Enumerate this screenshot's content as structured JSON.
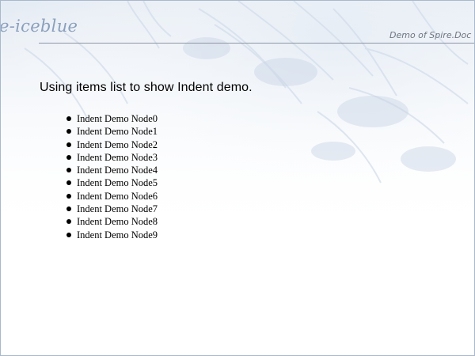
{
  "header": {
    "brand": "e-iceblue",
    "caption": "Demo of Spire.Doc"
  },
  "content": {
    "heading": "Using items list to show Indent demo.",
    "items": [
      "Indent Demo Node0",
      "Indent Demo Node1",
      "Indent Demo Node2",
      "Indent Demo Node3",
      "Indent Demo Node4",
      "Indent Demo Node5",
      "Indent Demo Node6",
      "Indent Demo Node7",
      "Indent Demo Node8",
      "Indent Demo Node9"
    ]
  },
  "colors": {
    "brand": "#8a9fbd",
    "rule": "#8d96a3",
    "page_border": "#a9b8cc"
  }
}
